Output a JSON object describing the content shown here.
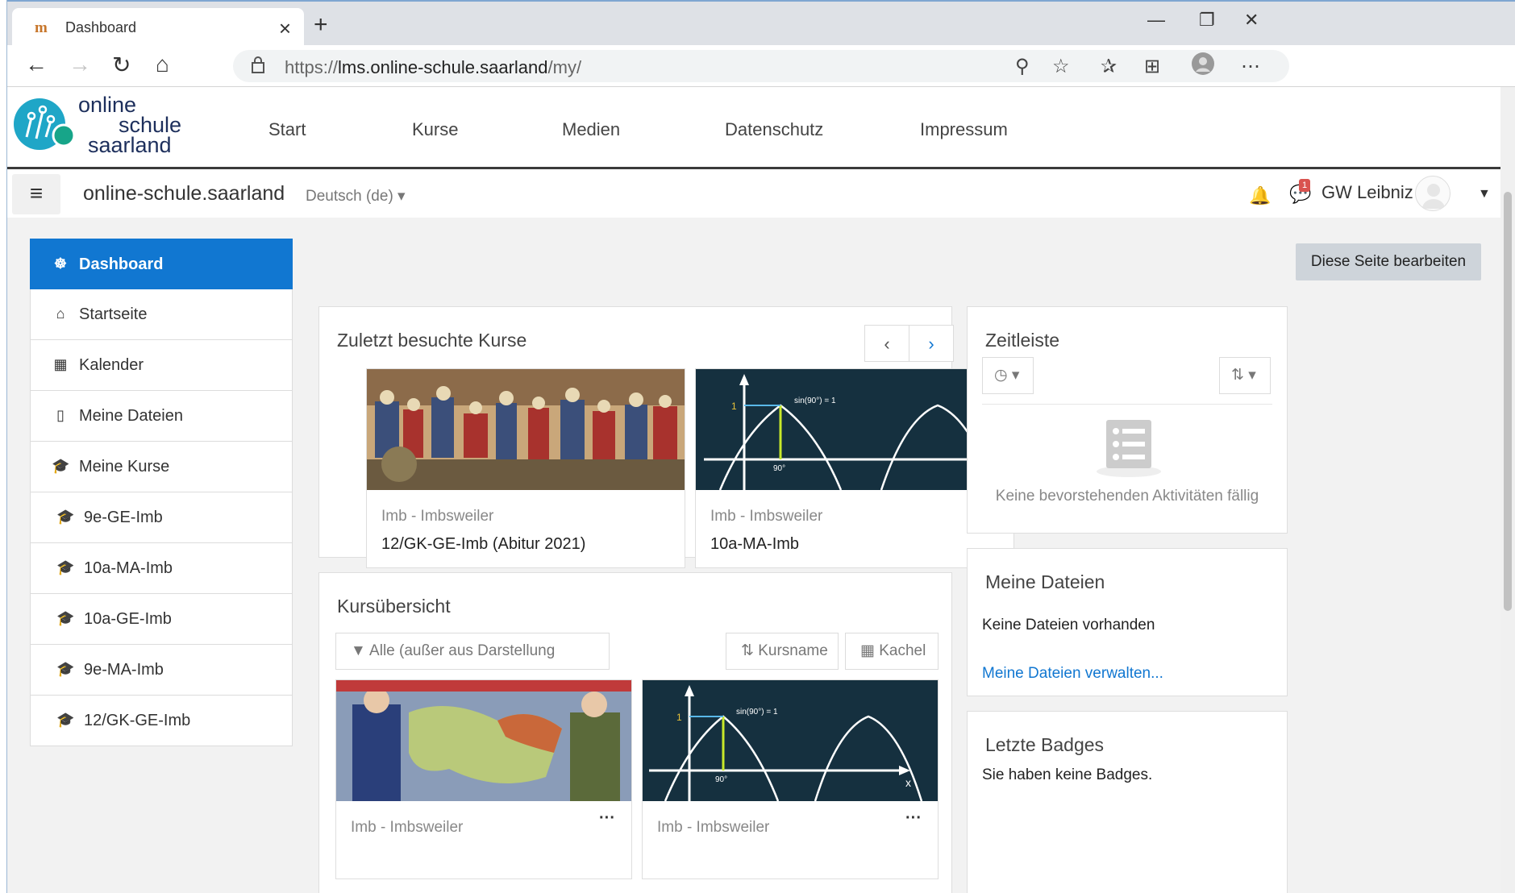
{
  "browser": {
    "tab_title": "Dashboard",
    "tab_favicon": "m",
    "url_prefix": "https://",
    "url_domain": "lms.online-schule.saarland",
    "url_path": "/my/"
  },
  "site": {
    "logo_line1": "online",
    "logo_line2": "schule",
    "logo_line3": "saarland",
    "nav": [
      "Start",
      "Kurse",
      "Medien",
      "Datenschutz",
      "Impressum"
    ]
  },
  "navbar": {
    "site_name": "online-schule.saarland",
    "language": "Deutsch (de)",
    "message_count": "1",
    "user_name": "GW Leibniz"
  },
  "drawer": {
    "items": [
      {
        "label": "Dashboard",
        "icon": "dashboard-icon",
        "glyph": "☸",
        "active": true
      },
      {
        "label": "Startseite",
        "icon": "home-icon",
        "glyph": "⌂"
      },
      {
        "label": "Kalender",
        "icon": "calendar-icon",
        "glyph": "▦"
      },
      {
        "label": "Meine Dateien",
        "icon": "file-icon",
        "glyph": "▯"
      },
      {
        "label": "Meine Kurse",
        "icon": "graduation-cap-icon",
        "glyph": "🎓"
      },
      {
        "label": "9e-GE-Imb",
        "icon": "graduation-cap-icon",
        "glyph": "🎓",
        "sub": true
      },
      {
        "label": "10a-MA-Imb",
        "icon": "graduation-cap-icon",
        "glyph": "🎓",
        "sub": true
      },
      {
        "label": "10a-GE-Imb",
        "icon": "graduation-cap-icon",
        "glyph": "🎓",
        "sub": true
      },
      {
        "label": "9e-MA-Imb",
        "icon": "graduation-cap-icon",
        "glyph": "🎓",
        "sub": true
      },
      {
        "label": "12/GK-GE-Imb",
        "icon": "graduation-cap-icon",
        "glyph": "🎓",
        "sub": true
      }
    ]
  },
  "main": {
    "edit_button": "Diese Seite bearbeiten",
    "recent": {
      "title": "Zuletzt besuchte Kurse",
      "courses": [
        {
          "category": "Imb - Imbsweiler",
          "name": "12/GK-GE-Imb (Abitur 2021)"
        },
        {
          "category": "Imb - Imbsweiler",
          "name": "10a-MA-Imb"
        }
      ]
    },
    "overview": {
      "title": "Kursübersicht",
      "filter": "Alle (außer aus Darstellung entfernte)",
      "sort": "Kursname",
      "view": "Kachel",
      "courses": [
        {
          "category": "Imb - Imbsweiler"
        },
        {
          "category": "Imb - Imbsweiler"
        }
      ]
    },
    "sine_label": "sin(90°) = 1",
    "sine_y": "1",
    "sine_x": "90°",
    "sine_axis": "x"
  },
  "blocks": {
    "timeline": {
      "title": "Zeitleiste",
      "empty": "Keine bevorstehenden Aktivitäten fällig"
    },
    "files": {
      "title": "Meine Dateien",
      "empty": "Keine Dateien vorhanden",
      "manage": "Meine Dateien verwalten..."
    },
    "badges": {
      "title": "Letzte Badges",
      "empty": "Sie haben keine Badges."
    }
  },
  "colors": {
    "accent": "#1177d1",
    "header_rule": "#3a3a3a",
    "logo_teal": "#1fa6c7"
  }
}
